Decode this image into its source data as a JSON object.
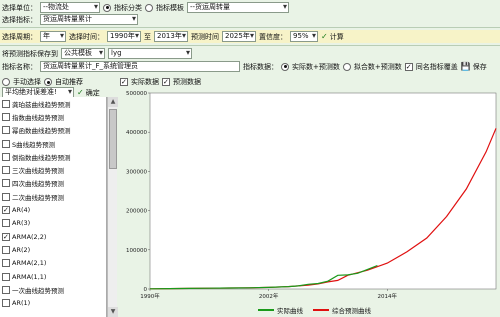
{
  "row1": {
    "unit_label": "选择单位：",
    "unit_value": "--物流处",
    "category_label": "指标分类",
    "template_label": "指标模板",
    "template_value": "--货运周转量"
  },
  "row2": {
    "indicator_label": "选择指标：",
    "indicator_value": "货运周转量累计"
  },
  "row3": {
    "period_label": "选择周期：",
    "period_value": "年",
    "time_label": "选择时间：",
    "start_year": "1990年",
    "to_label": "至",
    "end_year": "2013年",
    "forecast_label": "预测时间",
    "forecast_year": "2025年",
    "confidence_label": "置信度：",
    "confidence_value": "95%",
    "calc_label": "计算"
  },
  "row4": {
    "save_to_label": "将预测指标保存到",
    "save_target": "公共模板",
    "save_name": "lyg"
  },
  "row5": {
    "name_label": "指标名称：",
    "name_value": "货运周转量累计_F_系统管理员",
    "data_label": "指标数据：",
    "opt_actual": "实际数+预测数",
    "opt_fitted": "拟合数+预测数",
    "same_name_label": "同名指标覆盖",
    "save_label": "保存"
  },
  "left": {
    "manual_label": "手动选择",
    "auto_label": "自动推荐",
    "criterion_value": "平均绝对误差准!",
    "confirm_label": "确定",
    "methods": [
      {
        "label": "龚珀兹曲线趋势预测",
        "checked": false
      },
      {
        "label": "指数曲线趋势预测",
        "checked": false
      },
      {
        "label": "幂函数曲线趋势预测",
        "checked": false
      },
      {
        "label": "S曲线趋势预测",
        "checked": false
      },
      {
        "label": "倒指数曲线趋势预测",
        "checked": false
      },
      {
        "label": "三次曲线趋势预测",
        "checked": false
      },
      {
        "label": "四次曲线趋势预测",
        "checked": false
      },
      {
        "label": "二次曲线趋势预测",
        "checked": false
      },
      {
        "label": "AR(4)",
        "checked": true
      },
      {
        "label": "AR(3)",
        "checked": false
      },
      {
        "label": "ARMA(2,2)",
        "checked": true
      },
      {
        "label": "AR(2)",
        "checked": false
      },
      {
        "label": "ARMA(2,1)",
        "checked": false
      },
      {
        "label": "ARMA(1,1)",
        "checked": false
      },
      {
        "label": "一次曲线趋势预测",
        "checked": false
      },
      {
        "label": "AR(1)",
        "checked": false
      }
    ]
  },
  "chart_toggles": {
    "actual_label": "实际数据",
    "forecast_label": "预测数据"
  },
  "colors": {
    "actual": "#1a9a1a",
    "forecast": "#e01010"
  },
  "chart_data": {
    "type": "line",
    "ylim": [
      0,
      500000
    ],
    "xlim": [
      1990,
      2025
    ],
    "y_ticks": [
      "0",
      "100000",
      "200000",
      "300000",
      "400000",
      "500000"
    ],
    "x_ticks": [
      "1990年",
      "2002年",
      "2014年"
    ],
    "x_tick_values": [
      1990,
      2002,
      2014
    ],
    "series": [
      {
        "name": "实际曲线",
        "x": [
          1990,
          1992,
          1994,
          1996,
          1998,
          2000,
          2002,
          2004,
          2005,
          2006,
          2007,
          2008,
          2009,
          2010,
          2011,
          2012,
          2013
        ],
        "values": [
          500,
          1000,
          1500,
          2000,
          2500,
          3000,
          4000,
          6000,
          8000,
          12000,
          14000,
          20000,
          35000,
          36000,
          40000,
          50000,
          60000
        ]
      },
      {
        "name": "综合预测曲线",
        "x": [
          1990,
          1992,
          1994,
          1996,
          1998,
          2000,
          2002,
          2004,
          2006,
          2007,
          2008,
          2009,
          2010,
          2012,
          2014,
          2016,
          2018,
          2020,
          2022,
          2024,
          2025
        ],
        "values": [
          500,
          1000,
          1500,
          2000,
          2500,
          3000,
          4000,
          6000,
          10000,
          13000,
          18000,
          22000,
          35000,
          48000,
          66000,
          95000,
          130000,
          185000,
          255000,
          350000,
          410000
        ]
      }
    ]
  }
}
